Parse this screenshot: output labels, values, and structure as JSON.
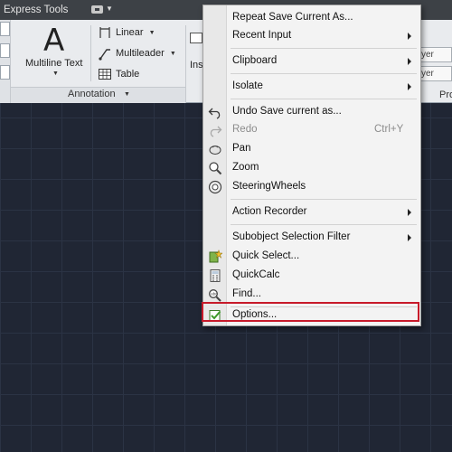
{
  "tabs": {
    "express_tools": "Express Tools"
  },
  "ribbon": {
    "multiline_text": "Multiline Text",
    "tools": [
      {
        "label": "Linear"
      },
      {
        "label": "Multileader"
      },
      {
        "label": "Table"
      }
    ],
    "panel_label": "Annotation",
    "insert_label_fragment": "Ins",
    "layer_fields": [
      "yer",
      "yer"
    ],
    "properties_label_fragment": "Pro"
  },
  "context_menu": {
    "items": [
      {
        "label": "Repeat Save Current As...",
        "submenu": false
      },
      {
        "label": "Recent Input",
        "submenu": true
      },
      {
        "label": "Clipboard",
        "submenu": true
      },
      {
        "label": "Isolate",
        "submenu": true
      },
      {
        "label": "Undo Save current as...",
        "icon": "undo-icon"
      },
      {
        "label": "Redo",
        "shortcut": "Ctrl+Y",
        "icon": "redo-icon",
        "disabled": true
      },
      {
        "label": "Pan",
        "icon": "pan-hand-icon"
      },
      {
        "label": "Zoom",
        "icon": "zoom-icon"
      },
      {
        "label": "SteeringWheels",
        "icon": "steering-wheel-icon"
      },
      {
        "label": "Action Recorder",
        "submenu": true
      },
      {
        "label": "Subobject Selection Filter",
        "submenu": true
      },
      {
        "label": "Quick Select...",
        "icon": "quick-select-icon"
      },
      {
        "label": "QuickCalc",
        "icon": "calculator-icon"
      },
      {
        "label": "Find...",
        "icon": "find-replace-icon"
      },
      {
        "label": "Options...",
        "icon": "options-checkbox-icon",
        "highlighted": true
      }
    ]
  },
  "colors": {
    "drawing_background": "#202634",
    "highlight_border": "#c71a2a",
    "menu_background": "#f3f3f3",
    "ribbon_background": "#e9ebee"
  }
}
